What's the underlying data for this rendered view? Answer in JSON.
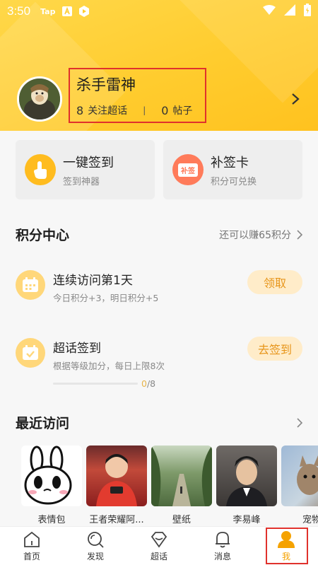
{
  "status_bar": {
    "time": "3:50",
    "icons": [
      "tap-icon",
      "a-icon",
      "play-icon"
    ],
    "right_icons": [
      "wifi-icon",
      "signal-icon",
      "battery-icon"
    ]
  },
  "profile": {
    "username": "杀手雷神",
    "follow_count": "8",
    "follow_label": "关注超话",
    "divider": "|",
    "post_count": "0",
    "post_label": "帖子"
  },
  "quick_cards": [
    {
      "title": "一键签到",
      "subtitle": "签到神器",
      "icon": "finger-tap-icon"
    },
    {
      "title": "补签卡",
      "subtitle": "积分可兑换",
      "icon": "makeup-card-icon",
      "icon_text": "补签"
    }
  ],
  "points": {
    "title": "积分中心",
    "link": "还可以赚65积分",
    "tasks": [
      {
        "title": "连续访问第1天",
        "subtitle": "今日积分+3，明日积分+5",
        "button": "领取",
        "icon": "calendar-icon"
      },
      {
        "title": "超话签到",
        "subtitle": "根据等级加分，每日上限8次",
        "button": "去签到",
        "icon": "checkin-icon",
        "progress_current": "0",
        "progress_total": "/8",
        "progress_fraction": 0
      }
    ]
  },
  "recent": {
    "title": "最近访问",
    "items": [
      {
        "label": "表情包"
      },
      {
        "label": "王者荣耀阿..."
      },
      {
        "label": "壁纸"
      },
      {
        "label": "李易峰"
      },
      {
        "label": "宠物"
      }
    ]
  },
  "tabbar": {
    "tabs": [
      {
        "label": "首页",
        "icon": "home-icon"
      },
      {
        "label": "发现",
        "icon": "discover-icon"
      },
      {
        "label": "超话",
        "icon": "diamond-icon"
      },
      {
        "label": "消息",
        "icon": "bell-icon"
      },
      {
        "label": "我",
        "icon": "profile-icon",
        "active": true
      }
    ]
  },
  "colors": {
    "header": "#ffcc2e",
    "accent": "#f5a200",
    "highlight_box": "#e0312c",
    "button_bg": "#ffecc9",
    "button_text": "#e7951a"
  }
}
